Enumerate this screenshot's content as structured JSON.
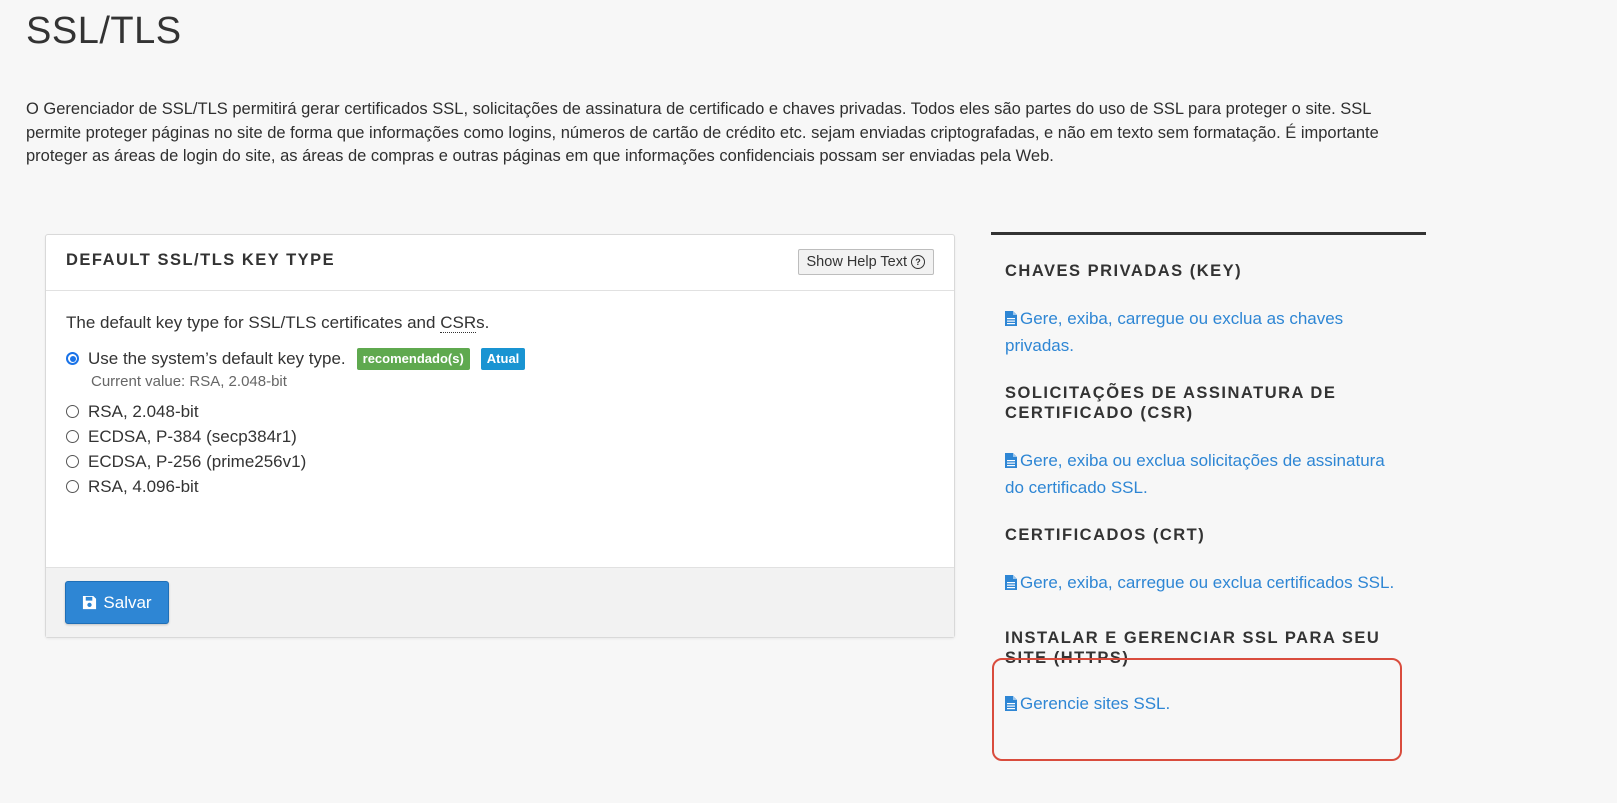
{
  "page": {
    "title": "SSL/TLS",
    "intro": "O Gerenciador de SSL/TLS permitirá gerar certificados SSL, solicitações de assinatura de certificado e chaves privadas. Todos eles são partes do uso de SSL para proteger o site. SSL permite proteger páginas no site de forma que informações como logins, números de cartão de crédito etc. sejam enviadas criptografadas, e não em texto sem formatação. É importante proteger as áreas de login do site, as áreas de compras e outras páginas em que informações confidenciais possam ser enviadas pela Web."
  },
  "key_panel": {
    "title": "DEFAULT SSL/TLS KEY TYPE",
    "help_button": "Show Help Text",
    "description_prefix": "The default key type for SSL/TLS certificates and ",
    "description_abbr": "CSR",
    "description_suffix": "s.",
    "options": [
      {
        "label": "Use the system’s default key type.",
        "checked": true
      },
      {
        "label": "RSA, 2.048-bit",
        "checked": false
      },
      {
        "label": "ECDSA, P-384 (secp384r1)",
        "checked": false
      },
      {
        "label": "ECDSA, P-256 (prime256v1)",
        "checked": false
      },
      {
        "label": "RSA, 4.096-bit",
        "checked": false
      }
    ],
    "badges": {
      "recommended": "recomendado(s)",
      "current": "Atual"
    },
    "current_value": "Current value: RSA, 2.048-bit",
    "save_label": "Salvar"
  },
  "sidebar": {
    "sections": [
      {
        "heading": "CHAVES PRIVADAS (KEY)",
        "link": "Gere, exiba, carregue ou exclua as chaves privadas."
      },
      {
        "heading": "SOLICITAÇÕES DE ASSINATURA DE CERTIFICADO (CSR)",
        "link": "Gere, exiba ou exclua solicitações de assinatura do certificado SSL."
      },
      {
        "heading": "CERTIFICADOS (CRT)",
        "link": "Gere, exiba, carregue ou exclua certificados SSL."
      },
      {
        "heading": "INSTALAR E GERENCIAR SSL PARA SEU SITE (HTTPS)",
        "link": "Gerencie sites SSL."
      }
    ]
  },
  "colors": {
    "accent": "#2e86d4",
    "badge_green": "#5fa94f",
    "badge_blue": "#1994d2",
    "highlight_border": "#d94c3d"
  }
}
